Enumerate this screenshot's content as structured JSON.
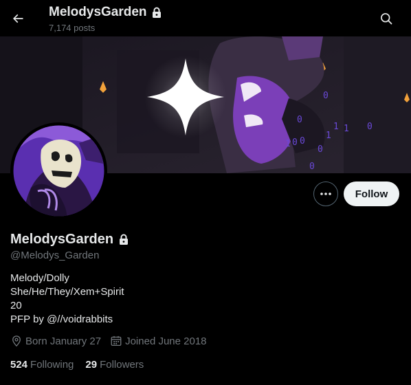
{
  "header": {
    "title": "MelodysGarden",
    "posts_count": "7,174 posts",
    "back_icon": "arrow-left-icon",
    "search_icon": "search-icon",
    "lock_icon": "lock-icon"
  },
  "profile": {
    "display_name": "MelodysGarden",
    "handle": "@Melodys_Garden",
    "bio_lines": [
      "Melody/Dolly",
      "She/He/They/Xem+Spirit",
      "20",
      "PFP by @//voidrabbits"
    ],
    "born": "Born January 27",
    "joined": "Joined June 2018",
    "following_count": "524",
    "following_label": "Following",
    "followers_count": "29",
    "followers_label": "Followers"
  },
  "actions": {
    "follow_label": "Follow",
    "more_icon": "more-icon"
  },
  "colors": {
    "background": "#000000",
    "primary_text": "#e7e9ea",
    "secondary_text": "#71767b",
    "follow_button_bg": "#eff3f4",
    "border": "#536471",
    "banner_purple": "#7b3fb8"
  }
}
